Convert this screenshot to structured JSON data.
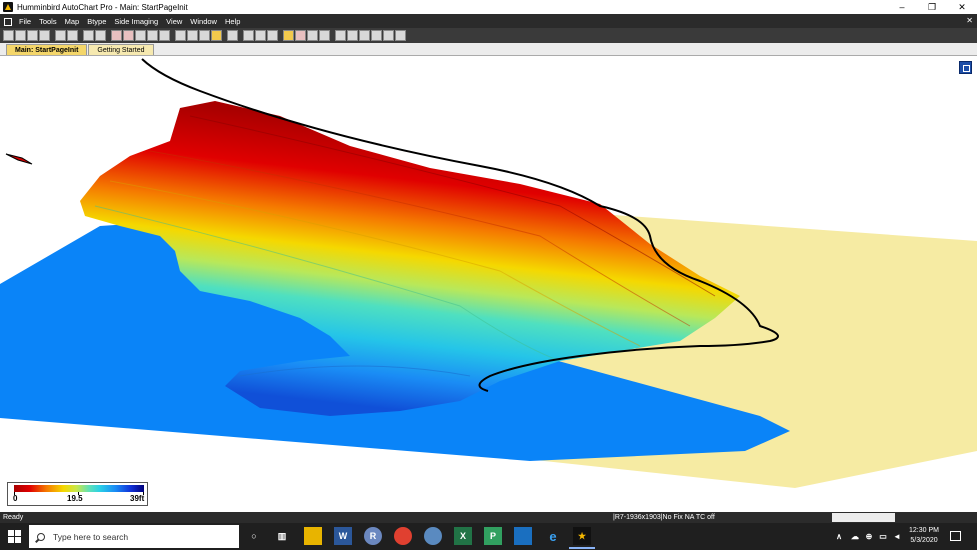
{
  "window": {
    "title": "Humminbird AutoChart Pro - Main: StartPageInit",
    "controls": {
      "minimize": "–",
      "maximize": "❐",
      "close": "✕"
    }
  },
  "menu": {
    "items": [
      "File",
      "Tools",
      "Map",
      "Btype",
      "Side Imaging",
      "View",
      "Window",
      "Help"
    ],
    "close_glyph": "✕"
  },
  "toolbar": {
    "buttons": [
      "new-icon",
      "open-icon",
      "save-icon",
      "print-icon",
      "zoom-in-icon",
      "zoom-out-icon",
      "page-icon",
      "layers-icon",
      "track-icon",
      "track2-icon",
      "track3-icon",
      "track4-icon",
      "track5-icon",
      "circle-icon",
      "circle2-icon",
      "square-icon",
      "shade-icon",
      "doc-icon",
      "gear-icon",
      "pin-icon",
      "camera-icon",
      "chart-icon",
      "color-icon",
      "marker-icon",
      "ruler-icon",
      "grid-icon",
      "house-icon",
      "boat-icon",
      "cloud-icon",
      "eraser-icon"
    ]
  },
  "tabs": [
    {
      "label": "Main: StartPageInit",
      "active": true
    },
    {
      "label": "Getting Started",
      "active": false
    }
  ],
  "legend": {
    "min_label": "0",
    "mid_label": "19.5",
    "max_label": "39ft"
  },
  "colors": {
    "water": "#0a84f8",
    "land": "#f6eba3",
    "shoreline": "#000000"
  },
  "statusbar": {
    "ready": "Ready",
    "info": "|R7-1936x1903|No Fix   NA  TC off"
  },
  "taskbar": {
    "search_placeholder": "Here to search",
    "search_text": "Type here to search",
    "apps": [
      "cortana-icon",
      "task-view-icon",
      "file-explorer-icon",
      "word-icon",
      "r-icon",
      "chrome-icon",
      "app-icon",
      "excel-icon",
      "project-icon",
      "photos-icon",
      "edge-icon",
      "autochart-icon"
    ],
    "time": "12:30 PM",
    "date": "5/3/2020"
  }
}
